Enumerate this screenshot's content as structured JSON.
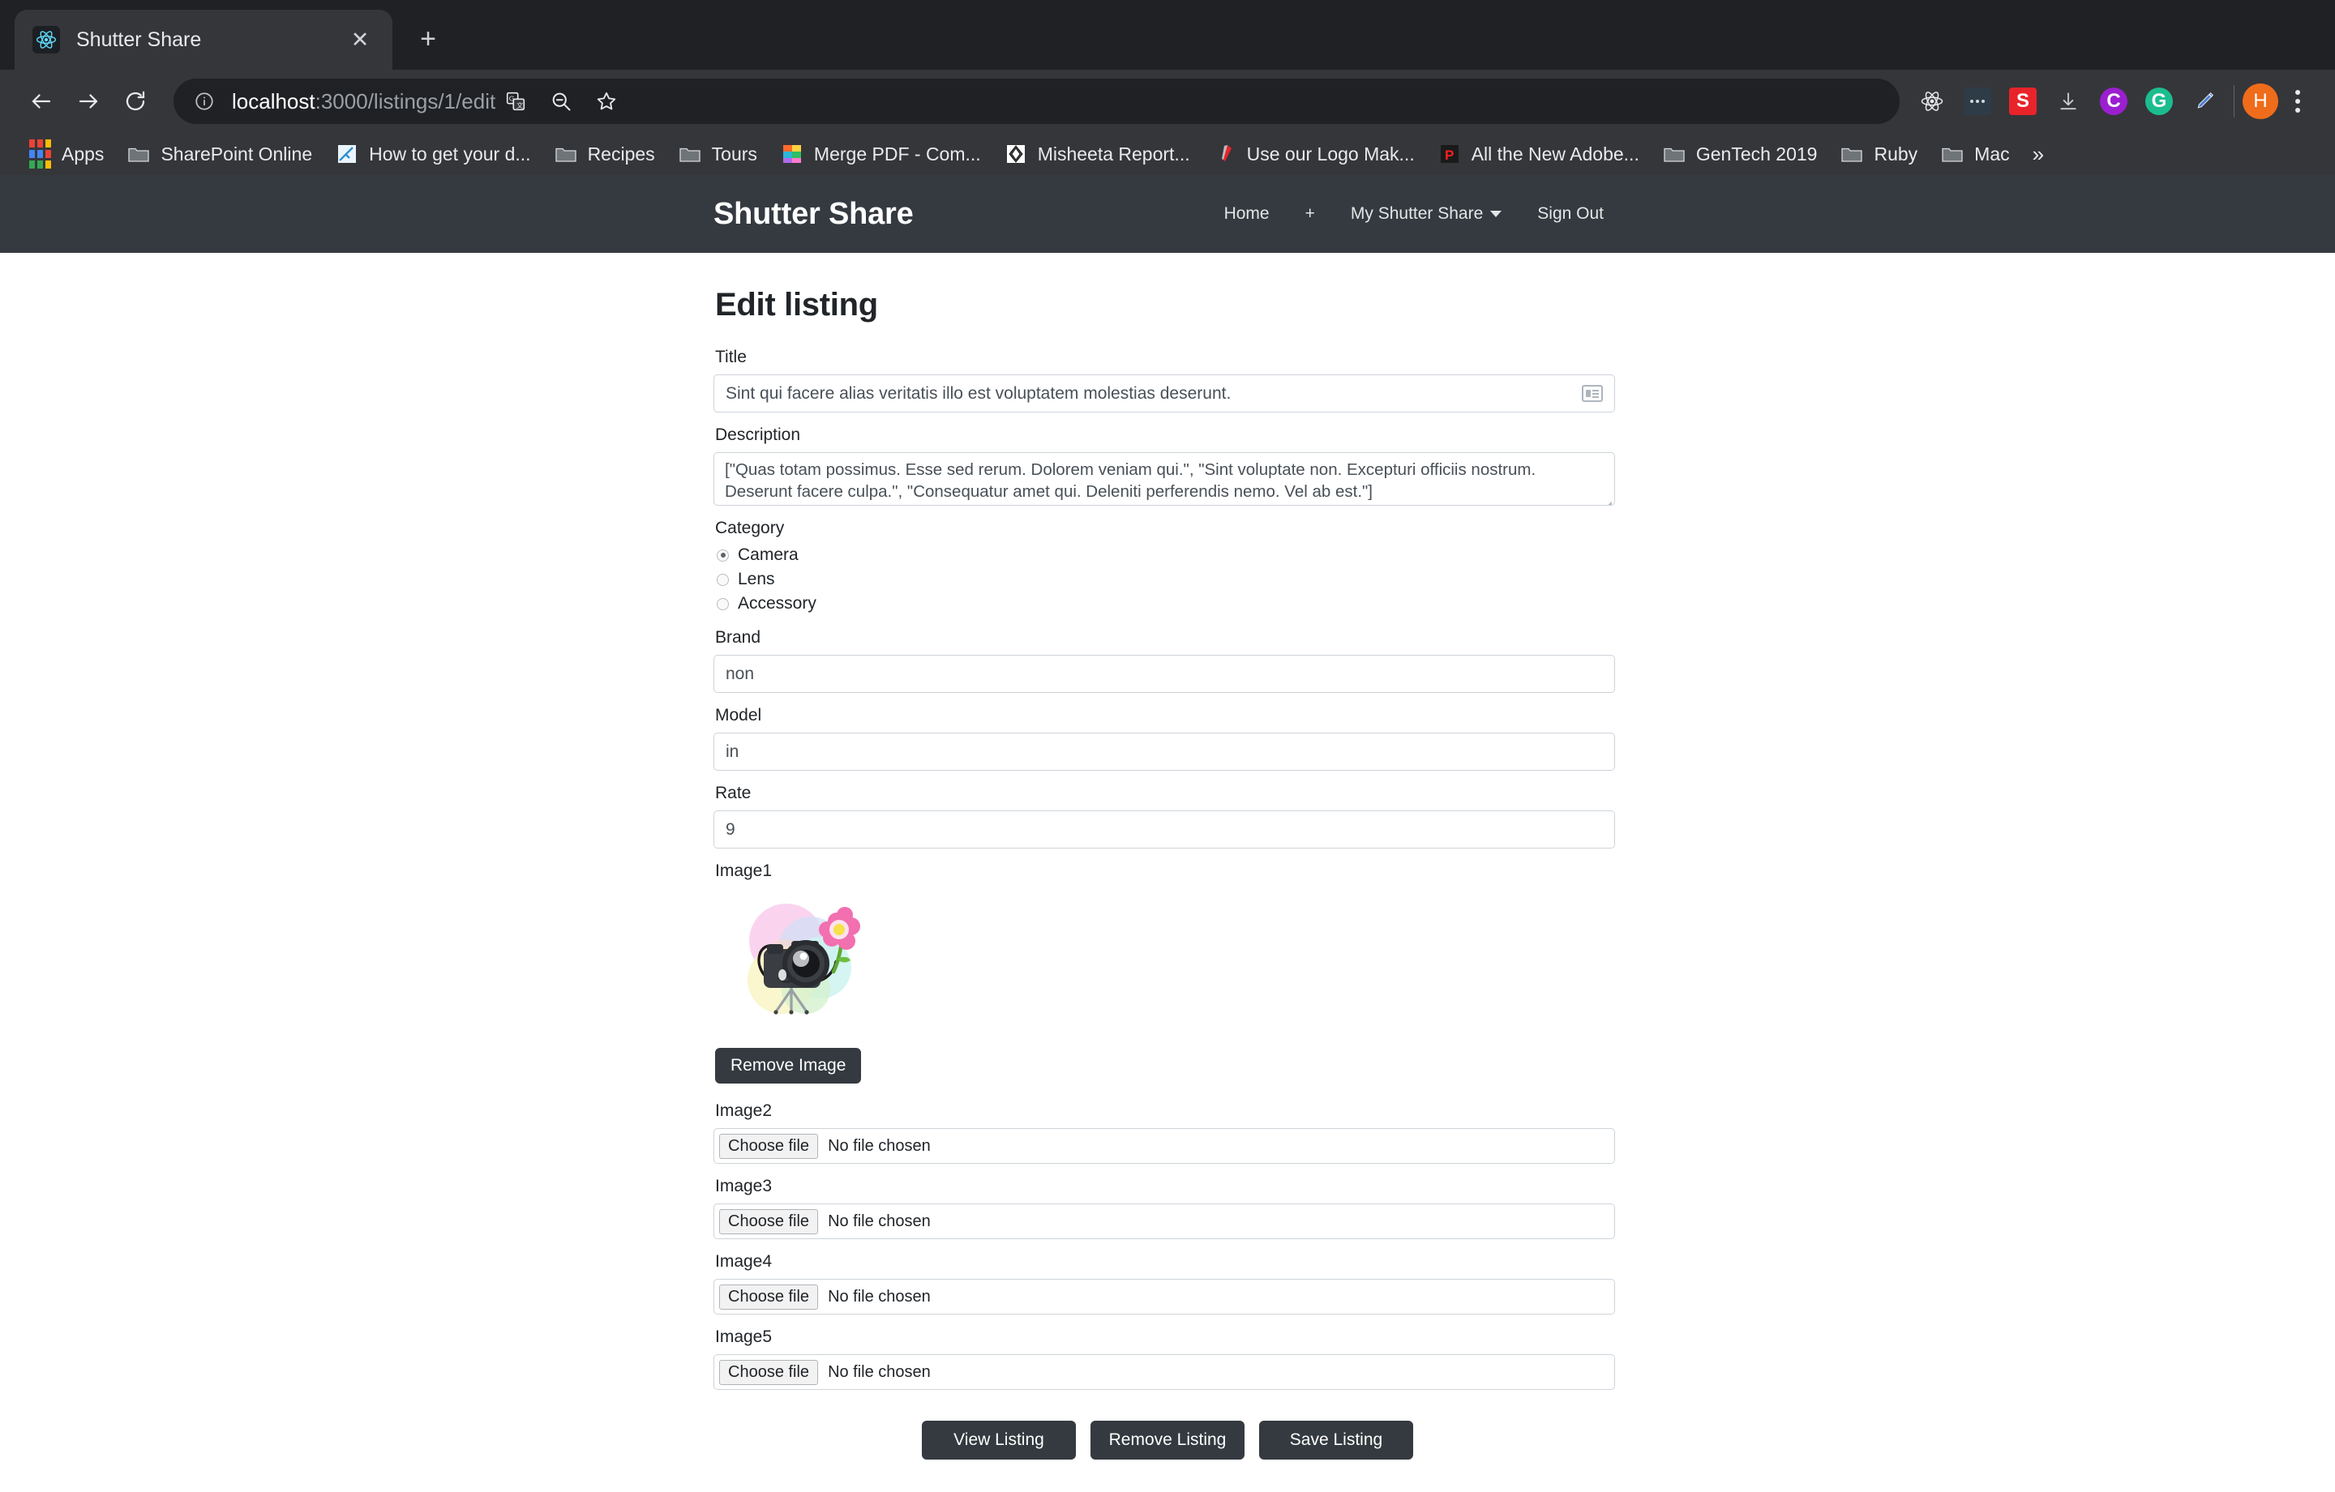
{
  "browser": {
    "tab": {
      "title": "Shutter Share",
      "favicon": "react-icon",
      "close": "✕"
    },
    "new_tab_label": "+",
    "url_prefix": "localhost",
    "url_suffix": ":3000/listings/1/edit",
    "nav": {
      "back": "←",
      "forward": "→",
      "reload": "↻"
    },
    "omni_icons": [
      "translate-icon",
      "zoom-out-icon",
      "star-icon"
    ],
    "extensions": [
      {
        "name": "react-devtools-icon",
        "label": "",
        "color": "#2d3239"
      },
      {
        "name": "dots-extension-icon",
        "label": "",
        "color": "#2e3c47"
      },
      {
        "name": "s-extension-icon",
        "label": "S",
        "color": "#e8242a"
      },
      {
        "name": "download-icon",
        "label": "",
        "color": "transparent"
      },
      {
        "name": "c-extension-icon",
        "label": "C",
        "color": "#9b1fd0"
      },
      {
        "name": "g-extension-icon",
        "label": "G",
        "color": "#1bbd8f"
      },
      {
        "name": "pen-extension-icon",
        "label": "",
        "color": "transparent"
      }
    ],
    "avatar_initial": "H",
    "bookmarks": [
      {
        "label": "Apps",
        "icon": "apps-grid-icon"
      },
      {
        "label": "SharePoint Online",
        "icon": "folder-icon"
      },
      {
        "label": "How to get your d...",
        "icon": "page-icon"
      },
      {
        "label": "Recipes",
        "icon": "folder-icon"
      },
      {
        "label": "Tours",
        "icon": "folder-icon"
      },
      {
        "label": "Merge PDF - Com...",
        "icon": "color-squares-icon"
      },
      {
        "label": "Misheeta Report...",
        "icon": "diamond-icon"
      },
      {
        "label": "Use our Logo Mak...",
        "icon": "red-pen-icon"
      },
      {
        "label": "All the New Adobe...",
        "icon": "p-icon"
      },
      {
        "label": "GenTech 2019",
        "icon": "folder-icon"
      },
      {
        "label": "Ruby",
        "icon": "folder-icon"
      },
      {
        "label": "Mac",
        "icon": "folder-icon"
      }
    ],
    "bookmarks_overflow": "»"
  },
  "app": {
    "brand": "Shutter Share",
    "nav_links": [
      {
        "label": "Home",
        "dropdown": false
      },
      {
        "label": "+",
        "dropdown": false
      },
      {
        "label": "My Shutter Share",
        "dropdown": true
      },
      {
        "label": "Sign Out",
        "dropdown": false
      }
    ]
  },
  "form": {
    "page_title": "Edit listing",
    "title": {
      "label": "Title",
      "value": "Sint qui facere alias veritatis illo est voluptatem molestias deserunt.",
      "placeholder": "Title"
    },
    "description": {
      "label": "Description",
      "value": "[\"Quas totam possimus. Esse sed rerum. Dolorem veniam qui.\", \"Sint voluptate non. Excepturi officiis nostrum. Deserunt facere culpa.\", \"Consequatur amet qui. Deleniti perferendis nemo. Vel ab est.\"]",
      "placeholder": "Description"
    },
    "category": {
      "label": "Category",
      "options": [
        "Camera",
        "Lens",
        "Accessory"
      ],
      "selected": "Camera"
    },
    "brand": {
      "label": "Brand",
      "value": "non",
      "placeholder": "Brand"
    },
    "model": {
      "label": "Model",
      "value": "in",
      "placeholder": "Model"
    },
    "rate": {
      "label": "Rate",
      "value": "9",
      "placeholder": "Rate"
    },
    "image1": {
      "label": "Image1",
      "alt": "camera-with-flower-illustration",
      "remove_label": "Remove Image"
    },
    "file_fields": [
      {
        "label": "Image2",
        "button": "Choose file",
        "status": "No file chosen"
      },
      {
        "label": "Image3",
        "button": "Choose file",
        "status": "No file chosen"
      },
      {
        "label": "Image4",
        "button": "Choose file",
        "status": "No file chosen"
      },
      {
        "label": "Image5",
        "button": "Choose file",
        "status": "No file chosen"
      }
    ],
    "actions": [
      {
        "label": "View Listing"
      },
      {
        "label": "Remove Listing"
      },
      {
        "label": "Save Listing"
      }
    ]
  },
  "colors": {
    "navbar": "#343a40",
    "chrome_dark": "#202124",
    "chrome_toolbar": "#35363a",
    "input_border": "#ced4da",
    "avatar": "#ef6c1a"
  }
}
